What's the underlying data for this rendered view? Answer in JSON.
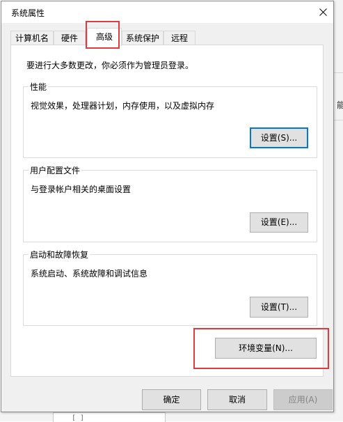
{
  "dialog": {
    "title": "系统属性"
  },
  "tabs": [
    {
      "label": "计算机名"
    },
    {
      "label": "硬件"
    },
    {
      "label": "高级"
    },
    {
      "label": "系统保护"
    },
    {
      "label": "远程"
    }
  ],
  "panel": {
    "notice": "要进行大多数更改，你必须作为管理员登录。",
    "performance": {
      "legend": "性能",
      "description": "视觉效果，处理器计划，内存使用，以及虚拟内存",
      "button": "设置(S)..."
    },
    "user_profiles": {
      "legend": "用户配置文件",
      "description": "与登录帐户相关的桌面设置",
      "button": "设置(E)..."
    },
    "startup_recovery": {
      "legend": "启动和故障恢复",
      "description": "系统启动、系统故障和调试信息",
      "button": "设置(T)..."
    },
    "env_button": "环境变量(N)..."
  },
  "footer": {
    "ok": "确定",
    "cancel": "取消",
    "apply": "应用(A)"
  },
  "background": {
    "side_text": "能",
    "bottom_text": "[ ]"
  },
  "colors": {
    "highlight": "#e0393e",
    "default_button_border": "#0078d7",
    "dialog_bg": "#f0f0f0"
  },
  "icons": {
    "close": "close-icon"
  }
}
